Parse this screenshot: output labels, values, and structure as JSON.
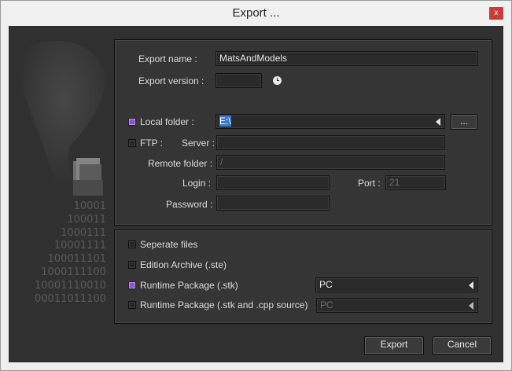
{
  "window": {
    "title": "Export ...",
    "close_label": "x"
  },
  "binary_art": [
    "10001",
    "100011",
    "1000111",
    "10001111",
    "100011101",
    "1000111100",
    "10001110010",
    "00011011100"
  ],
  "export": {
    "name_label": "Export name :",
    "name_value": "MatsAndModels",
    "version_label": "Export version :",
    "version_value": ""
  },
  "local_folder": {
    "checked": true,
    "label": "Local folder :",
    "value": "E:\\",
    "browse_label": "..."
  },
  "ftp": {
    "checked": false,
    "label": "FTP :",
    "server_label": "Server :",
    "server_value": "",
    "remote_folder_label": "Remote folder :",
    "remote_folder_value": "/",
    "login_label": "Login :",
    "login_value": "",
    "port_label": "Port :",
    "port_value": "21",
    "password_label": "Password :",
    "password_value": ""
  },
  "options": {
    "separate_files": {
      "checked": false,
      "label": "Seperate files"
    },
    "edition_archive": {
      "checked": false,
      "label": "Edition Archive (.ste)"
    },
    "runtime_package": {
      "checked": true,
      "label": "Runtime Package (.stk)",
      "platform": "PC"
    },
    "runtime_package_src": {
      "checked": false,
      "label": "Runtime Package (.stk and .cpp source)",
      "platform": "PC"
    }
  },
  "buttons": {
    "export_label": "Export",
    "cancel_label": "Cancel"
  },
  "colors": {
    "accent_check": "#8a55c6",
    "selection": "#3b78c6",
    "close": "#c83c3c"
  }
}
